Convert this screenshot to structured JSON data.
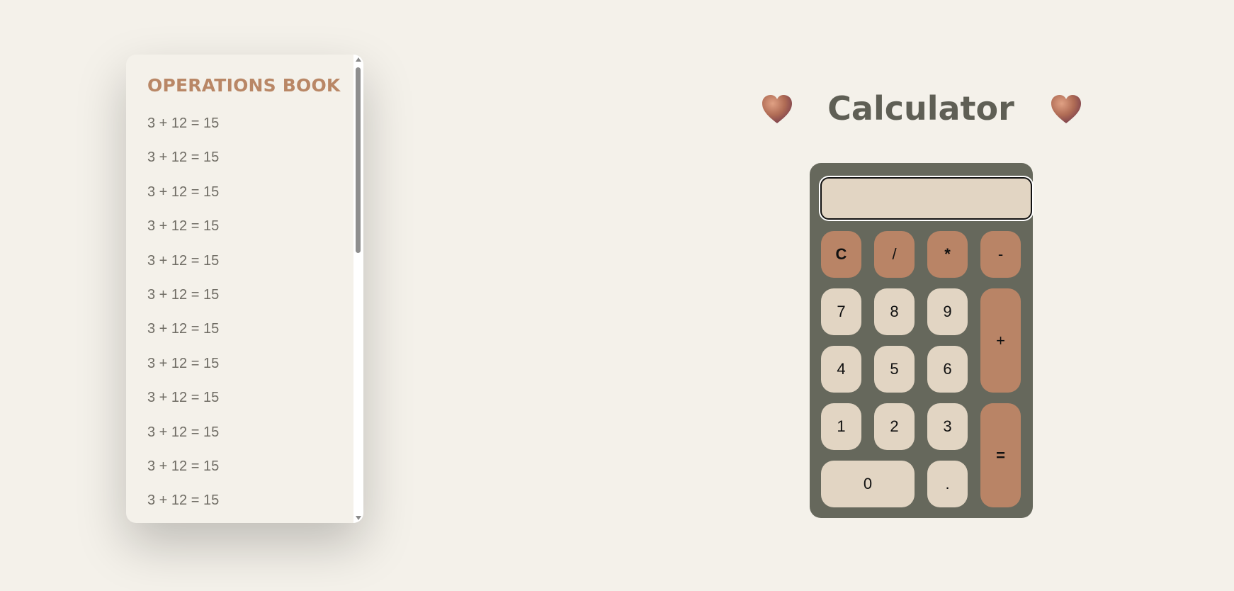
{
  "colors": {
    "background": "#f4f1ea",
    "accent": "#b98766",
    "calculator_body": "#66685c",
    "number_key": "#e2d5c3",
    "operator_key": "#b98466",
    "title_text": "#5f5f55"
  },
  "operations_book": {
    "title": "OPERATIONS BOOK",
    "entries": [
      "3 + 12 = 15",
      "3 + 12 = 15",
      "3 + 12 = 15",
      "3 + 12 = 15",
      "3 + 12 = 15",
      "3 + 12 = 15",
      "3 + 12 = 15",
      "3 + 12 = 15",
      "3 + 12 = 15",
      "3 + 12 = 15",
      "3 + 12 = 15",
      "3 + 12 = 15"
    ]
  },
  "calculator": {
    "title": "Calculator",
    "decoration_icon": "heart-icon",
    "display_value": "",
    "keys": {
      "clear": "C",
      "divide": "/",
      "multiply": "*",
      "subtract": "-",
      "seven": "7",
      "eight": "8",
      "nine": "9",
      "add": "+",
      "four": "4",
      "five": "5",
      "six": "6",
      "one": "1",
      "two": "2",
      "three": "3",
      "equals": "=",
      "zero": "0",
      "decimal": "."
    }
  }
}
